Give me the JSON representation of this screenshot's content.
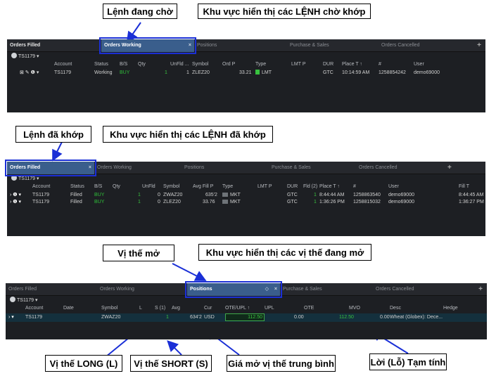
{
  "callouts": {
    "working_label": "Lệnh đang chờ",
    "working_desc": "Khu vực hiển thị các LỆNH chờ khớp",
    "filled_label": "Lệnh đã khớp",
    "filled_desc": "Khu vực hiển thị các LỆNH đã khớp",
    "positions_label": "Vị thế mở",
    "positions_desc": "Khu vực hiển thị các vị thế đang mở",
    "long_label": "Vị thế LONG (L)",
    "short_label": "Vị thế SHORT (S)",
    "avg_label": "Giá mở vị thế trung bình",
    "pnl_label": "Lời (Lỗ) Tạm tính"
  },
  "tabs": {
    "orders_filled": "Orders Filled",
    "orders_working": "Orders Working",
    "positions": "Positions",
    "purchase_sales": "Purchase & Sales",
    "orders_cancelled": "Orders Cancelled",
    "close": "×",
    "plus": "+",
    "pin": "◇"
  },
  "account_selector": "TS1179 ▾",
  "working": {
    "headers": [
      "Account",
      "Status",
      "B/S",
      "Qty",
      "UnFld ...",
      "Symbol",
      "Ord P",
      "Type",
      "LMT P",
      "DUR",
      "Place T ↑",
      "#",
      "User"
    ],
    "row": {
      "icons": "⊠ ✎ ❶ ▾",
      "account": "TS1179",
      "status": "Working",
      "bs": "BUY",
      "qty": "1",
      "unfld": "1",
      "symbol": "ZLEZ20",
      "ordp": "33.21",
      "type": "LMT",
      "dur": "GTC",
      "place": "10:14:59 AM",
      "num": "1258854242",
      "user": "demo69000"
    }
  },
  "filled": {
    "headers": [
      "Account",
      "Status",
      "B/S",
      "Qty",
      "UnFld",
      "Symbol",
      "Avg Fill P",
      "Type",
      "LMT P",
      "DUR",
      "Fld (2)",
      "Place T ↑",
      "#",
      "User",
      "Fill T"
    ],
    "rows": [
      {
        "account": "TS1179",
        "status": "Filled",
        "bs": "BUY",
        "qty": "1",
        "unfld": "0",
        "symbol": "ZWAZ20",
        "avg": "635'2",
        "type": "MKT",
        "dur": "GTC",
        "fld": "1",
        "place": "8:44:44 AM",
        "num": "1258863540",
        "user": "demo69000",
        "fill": "8:44:45 AM"
      },
      {
        "account": "TS1179",
        "status": "Filled",
        "bs": "BUY",
        "qty": "1",
        "unfld": "0",
        "symbol": "ZLEZ20",
        "avg": "33.76",
        "type": "MKT",
        "dur": "GTC",
        "fld": "1",
        "place": "1:36:26 PM",
        "num": "1258815032",
        "user": "demo69000",
        "fill": "1:36:27 PM"
      }
    ]
  },
  "positions": {
    "headers": [
      "Account",
      "Date",
      "Symbol",
      "L",
      "S (1)",
      "Avg",
      "Cur",
      "OTE/UPL ↑",
      "UPL",
      "OTE",
      "MVO",
      "Desc",
      "Hedge"
    ],
    "row": {
      "account": "TS1179",
      "symbol": "ZWAZ20",
      "s": "1",
      "avg": "634'2",
      "cur": "USD",
      "oteupl": "112.50",
      "upl": "0.00",
      "ote": "112.50",
      "mvo": "0.00",
      "desc": "Wheat (Globex): Dece..."
    }
  }
}
